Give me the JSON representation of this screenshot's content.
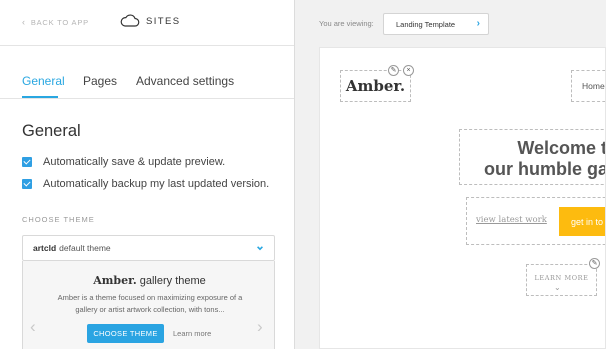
{
  "header": {
    "back_label": "BACK TO APP",
    "title": "SITES"
  },
  "tabs": [
    {
      "label": "General",
      "active": true
    },
    {
      "label": "Pages",
      "active": false
    },
    {
      "label": "Advanced settings",
      "active": false
    }
  ],
  "general": {
    "title": "General",
    "checkboxes": [
      {
        "label": "Automatically save & update preview.",
        "checked": true
      },
      {
        "label": "Automatically backup my last updated version.",
        "checked": true
      }
    ],
    "choose_theme_label": "CHOOSE THEME",
    "theme_select": {
      "name": "artcld",
      "suffix": "default theme"
    },
    "theme_card": {
      "name": "Amber.",
      "suffix": "gallery theme",
      "description": "Amber is a theme focused on maximizing exposure of a gallery or artist artwork collection, with tons...",
      "choose_button": "CHOOSE THEME",
      "learn_more": "Learn more"
    }
  },
  "preview": {
    "viewing_label": "You are viewing:",
    "selected_page": "Landing Template",
    "logo": "Amber.",
    "nav_item": "Home",
    "hero_line1": "Welcome to",
    "hero_line2": "our humble gall",
    "view_latest": "view latest work",
    "get_in": "get in to",
    "learn_more": "LEARN MORE"
  },
  "colors": {
    "accent": "#29a7e1",
    "cta": "#fdbb0f",
    "preview_bg": "#f1f1f1"
  }
}
